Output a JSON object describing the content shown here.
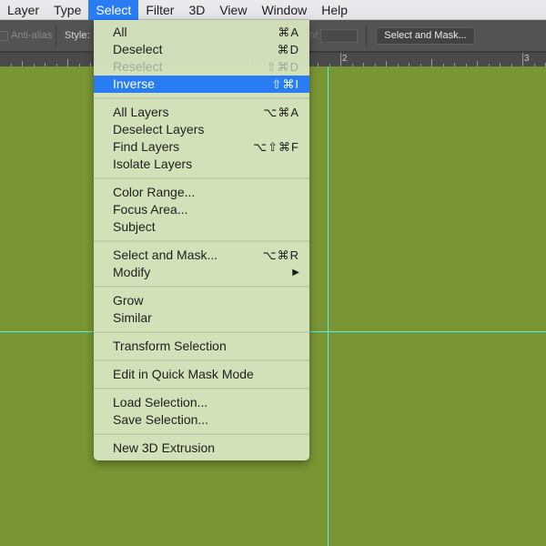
{
  "menubar": {
    "items": [
      {
        "label": "Layer"
      },
      {
        "label": "Type"
      },
      {
        "label": "Select",
        "active": true
      },
      {
        "label": "Filter"
      },
      {
        "label": "3D"
      },
      {
        "label": "View"
      },
      {
        "label": "Window"
      },
      {
        "label": "Help"
      }
    ]
  },
  "optionsbar": {
    "antialias_label": "Anti-alias",
    "style_label": "Style:",
    "height_label": "ht:",
    "select_and_mask_button": "Select and Mask..."
  },
  "ruler": {
    "labels": [
      "2",
      "3"
    ]
  },
  "colors": {
    "canvas": "#7a9634",
    "guide": "#4cf3e1",
    "menu_highlight": "#2a7cf4",
    "menu_background": "#d6e3be"
  },
  "select_menu": {
    "groups": [
      [
        {
          "label": "All",
          "shortcut": "⌘A"
        },
        {
          "label": "Deselect",
          "shortcut": "⌘D"
        },
        {
          "label": "Reselect",
          "shortcut": "⇧⌘D",
          "disabled": true
        },
        {
          "label": "Inverse",
          "shortcut": "⇧⌘I",
          "highlighted": true
        }
      ],
      [
        {
          "label": "All Layers",
          "shortcut": "⌥⌘A"
        },
        {
          "label": "Deselect Layers",
          "shortcut": ""
        },
        {
          "label": "Find Layers",
          "shortcut": "⌥⇧⌘F"
        },
        {
          "label": "Isolate Layers",
          "shortcut": ""
        }
      ],
      [
        {
          "label": "Color Range...",
          "shortcut": ""
        },
        {
          "label": "Focus Area...",
          "shortcut": ""
        },
        {
          "label": "Subject",
          "shortcut": ""
        }
      ],
      [
        {
          "label": "Select and Mask...",
          "shortcut": "⌥⌘R"
        },
        {
          "label": "Modify",
          "shortcut": "",
          "submenu": true
        }
      ],
      [
        {
          "label": "Grow",
          "shortcut": ""
        },
        {
          "label": "Similar",
          "shortcut": ""
        }
      ],
      [
        {
          "label": "Transform Selection",
          "shortcut": ""
        }
      ],
      [
        {
          "label": "Edit in Quick Mask Mode",
          "shortcut": ""
        }
      ],
      [
        {
          "label": "Load Selection...",
          "shortcut": ""
        },
        {
          "label": "Save Selection...",
          "shortcut": ""
        }
      ],
      [
        {
          "label": "New 3D Extrusion",
          "shortcut": ""
        }
      ]
    ],
    "submenu_arrow": "▶"
  }
}
